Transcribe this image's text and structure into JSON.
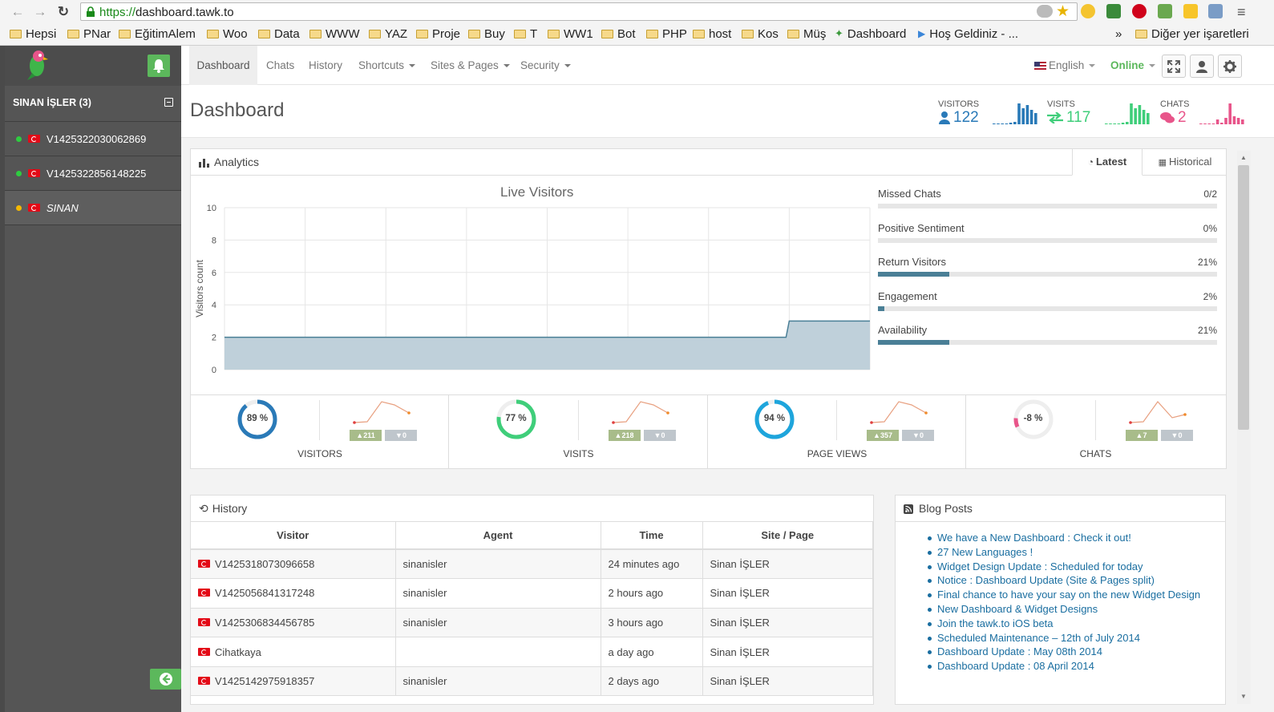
{
  "browser": {
    "url_scheme": "https://",
    "url_host": "dashboard.tawk.to",
    "bookmarks": [
      "Hepsi",
      "PNar",
      "EğitimAlem",
      "Woo",
      "Data",
      "WWW",
      "YAZ",
      "Proje",
      "Buy",
      "T",
      "WW1",
      "Bot",
      "PHP",
      "host",
      "Kos",
      "Müş",
      "Dashboard",
      "Hoş Geldiniz - ..."
    ],
    "overflow": "»",
    "other_bookmarks": "Diğer yer işaretleri"
  },
  "sidebar": {
    "group_title": "SINAN İŞLER (3)",
    "items": [
      {
        "label": "V1425322030062869",
        "status_color": "#2ecc40"
      },
      {
        "label": "V1425322856148225",
        "status_color": "#2ecc40"
      },
      {
        "label": "SINAN",
        "status_color": "#f5b800"
      }
    ]
  },
  "nav": {
    "items": [
      "Dashboard",
      "Chats",
      "History",
      "Shortcuts",
      "Sites & Pages",
      "Security"
    ],
    "language": "English",
    "status": "Online"
  },
  "page": {
    "title": "Dashboard",
    "stats": [
      {
        "label": "VISITORS",
        "value": "122",
        "color": "#2a7ab8"
      },
      {
        "label": "VISITS",
        "value": "117",
        "color": "#3fce7a"
      },
      {
        "label": "CHATS",
        "value": "2",
        "color": "#e8558a"
      }
    ]
  },
  "analytics": {
    "title": "Analytics",
    "tabs": [
      "Latest",
      "Historical"
    ],
    "metrics": [
      {
        "label": "Missed Chats",
        "value": "0/2",
        "pct": 0
      },
      {
        "label": "Positive Sentiment",
        "value": "0%",
        "pct": 0
      },
      {
        "label": "Return Visitors",
        "value": "21%",
        "pct": 21
      },
      {
        "label": "Engagement",
        "value": "2%",
        "pct": 2
      },
      {
        "label": "Availability",
        "value": "21%",
        "pct": 21
      }
    ],
    "kpis": [
      {
        "label": "VISITORS",
        "gauge": "89 %",
        "pct": 89,
        "color": "#2a7ab8",
        "up": "211",
        "down": "0"
      },
      {
        "label": "VISITS",
        "gauge": "77 %",
        "pct": 77,
        "color": "#3fce7a",
        "up": "218",
        "down": "0"
      },
      {
        "label": "PAGE VIEWS",
        "gauge": "94 %",
        "pct": 94,
        "color": "#1ea5dc",
        "up": "357",
        "down": "0"
      },
      {
        "label": "CHATS",
        "gauge": "-8 %",
        "pct": 8,
        "color": "#e8558a",
        "up": "7",
        "down": "0"
      }
    ]
  },
  "chart_data": {
    "type": "area",
    "title": "Live Visitors",
    "ylabel": "Visitors count",
    "xlabel": "",
    "ylim": [
      0,
      10
    ],
    "yticks": [
      0,
      2,
      4,
      6,
      8,
      10
    ],
    "grid": true,
    "x": [
      0,
      1,
      2,
      3,
      4,
      5,
      6,
      7,
      8
    ],
    "series": [
      {
        "values": [
          2,
          2,
          2,
          2,
          2,
          2,
          2,
          3,
          3
        ]
      }
    ]
  },
  "history": {
    "title": "History",
    "columns": [
      "Visitor",
      "Agent",
      "Time",
      "Site / Page"
    ],
    "rows": [
      [
        "V1425318073096658",
        "sinanisler",
        "24 minutes ago",
        "Sinan İŞLER"
      ],
      [
        "V1425056841317248",
        "sinanisler",
        "2 hours ago",
        "Sinan İŞLER"
      ],
      [
        "V1425306834456785",
        "sinanisler",
        "3 hours ago",
        "Sinan İŞLER"
      ],
      [
        "Cihatkaya",
        "",
        "a day ago",
        "Sinan İŞLER"
      ],
      [
        "V1425142975918357",
        "sinanisler",
        "2 days ago",
        "Sinan İŞLER"
      ]
    ]
  },
  "blog": {
    "title": "Blog Posts",
    "posts": [
      "We have a New Dashboard : Check it out!",
      "27 New Languages !",
      "Widget Design Update : Scheduled for today",
      "Notice : Dashboard Update (Site & Pages split)",
      "Final chance to have your say on the new Widget Design",
      "New Dashboard & Widget Designs",
      "Join the tawk.to iOS beta",
      "Scheduled Maintenance – 12th of July 2014",
      "Dashboard Update : May 08th 2014",
      "Dashboard Update : 08 April 2014"
    ]
  }
}
